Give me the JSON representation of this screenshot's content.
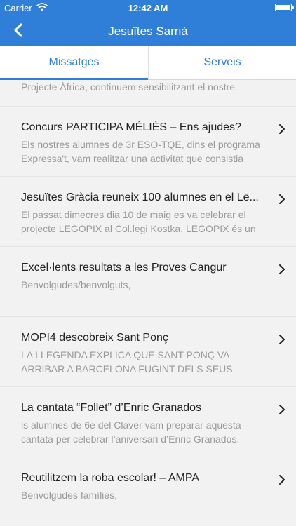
{
  "status_bar": {
    "carrier": "Carrier",
    "time": "12:42 AM",
    "wifi_icon": "wifi-icon",
    "battery_icon": "battery-icon"
  },
  "nav": {
    "title": "Jesuïtes Sarrià",
    "back_icon": "chevron-left-icon"
  },
  "tabs": [
    {
      "label": "Missatges",
      "active": true
    },
    {
      "label": "Serveis",
      "active": false
    }
  ],
  "colors": {
    "brand": "#2f7fd8",
    "background": "#f2f2f2",
    "title_text": "#222222",
    "description_text": "#9a9a9a"
  },
  "partial_item": {
    "description": "Projecte Àfrica, continuem sensibilitzant el nostre"
  },
  "messages": [
    {
      "title": "Concurs PARTICIPA MÉLIÈS – Ens ajudes?",
      "description": "Els nostres alumnes de 3r ESO-TQE, dins el programa\nExpressa't, vam realitzar una activitat que consistia"
    },
    {
      "title": "Jesuïtes Gràcia reuneix 100 alumnes en el Le...",
      "description": "El passat dimecres dia 10 de maig es va celebrar el\nprojecte LEGOPIX al Col.legi Kostka. LEGOPIX és un"
    },
    {
      "title": "Excel·lents resultats a les Proves Cangur",
      "description": "Benvolgudes/benvolguts,"
    },
    {
      "title": "MOPI4 descobreix Sant Ponç",
      "description": "LA LLEGENDA EXPLICA QUE SANT PONÇ VA\nARRIBAR A BARCELONA FUGINT DELS SEUS"
    },
    {
      "title": "La cantata “Follet” d’Enric Granados",
      "description": "ls alumnes de 6è del Claver vam preparar aquesta\ncantata per celebrar l’aniversari d’Enric Granados."
    },
    {
      "title": "Reutilitzem la roba escolar! – AMPA",
      "description": "Benvolgudes famílies,"
    }
  ]
}
